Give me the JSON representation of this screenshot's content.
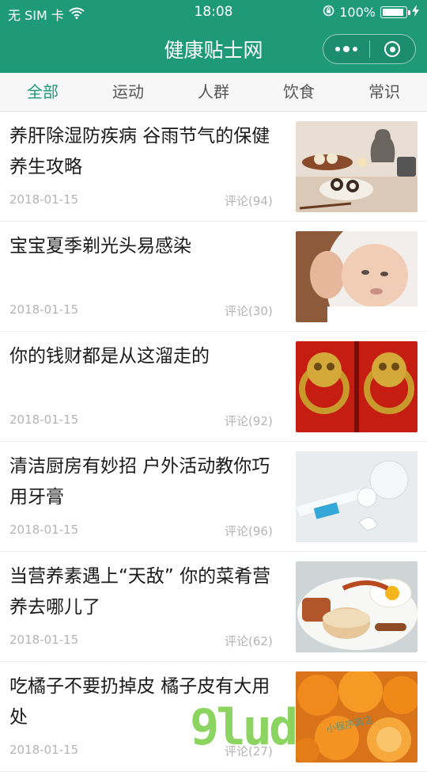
{
  "status_bar": {
    "carrier": "无 SIM 卡",
    "time": "18:08",
    "battery": "100%",
    "icons": [
      "wifi-icon",
      "orientation-lock-icon",
      "battery-icon",
      "charging-bolt-icon"
    ]
  },
  "nav": {
    "title": "健康贴士网",
    "menu_icon": "more-dots-icon",
    "close_icon": "target-close-icon"
  },
  "colors": {
    "brand": "#1f9a78",
    "tab_active": "#1f9a78",
    "meta_text": "#b4b4b4"
  },
  "tabs": [
    {
      "label": "全部",
      "active": true
    },
    {
      "label": "运动",
      "active": false
    },
    {
      "label": "人群",
      "active": false
    },
    {
      "label": "饮食",
      "active": false
    },
    {
      "label": "常识",
      "active": false
    }
  ],
  "articles": [
    {
      "title": "养肝除湿防疾病 谷雨节气的保健养生攻略",
      "date": "2018-01-15",
      "comments": "评论(94)",
      "image": "tea-sushi-photo"
    },
    {
      "title": "宝宝夏季剃光头易感染",
      "date": "2018-01-15",
      "comments": "评论(30)",
      "image": "mother-baby-photo"
    },
    {
      "title": "你的钱财都是从这溜走的",
      "date": "2018-01-15",
      "comments": "评论(92)",
      "image": "door-knocker-photo"
    },
    {
      "title": "清洁厨房有妙招 户外活动教你巧用牙膏",
      "date": "2018-01-15",
      "comments": "评论(96)",
      "image": "toothpaste-photo"
    },
    {
      "title": "当营养素遇上“天敌” 你的菜肴营养去哪儿了",
      "date": "2018-01-15",
      "comments": "评论(62)",
      "image": "breakfast-plate-photo"
    },
    {
      "title": "吃橘子不要扔掉皮 橘子皮有大用处",
      "date": "2018-01-15",
      "comments": "评论(27)",
      "image": "oranges-photo"
    }
  ],
  "watermark": {
    "text": "9lud",
    "sub": "小程序商店"
  }
}
